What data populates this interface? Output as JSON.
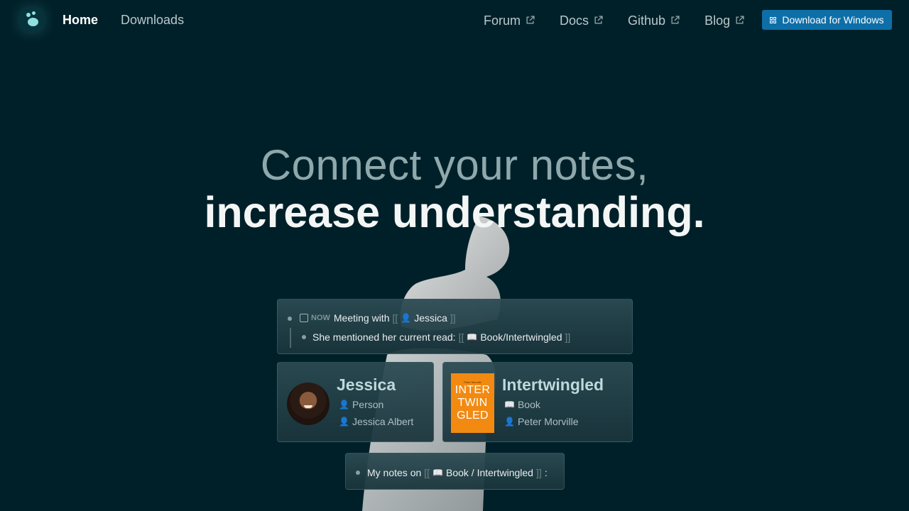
{
  "nav": {
    "home": "Home",
    "downloads": "Downloads",
    "links": [
      "Forum",
      "Docs",
      "Github",
      "Blog"
    ],
    "download_button": "Download for Windows"
  },
  "hero": {
    "line1": "Connect your notes,",
    "line2": "increase understanding."
  },
  "outline": {
    "status": "NOW",
    "meeting_text": "Meeting with",
    "meeting_ref": "Jessica",
    "mention_text": "She mentioned her current read:",
    "mention_ref": "Book/Intertwingled",
    "open_brackets": "[[",
    "close_brackets": "]]"
  },
  "person_card": {
    "title": "Jessica",
    "type": "Person",
    "full_name": "Jessica Albert"
  },
  "book_card": {
    "title": "Intertwingled",
    "type": "Book",
    "author": "Peter Morville",
    "cover_top": "Peter Morville",
    "cover_lines": [
      "INTER",
      "TWIN",
      "GLED"
    ]
  },
  "notes": {
    "prefix": "My notes on",
    "ref": "Book / Intertwingled",
    "suffix": ":"
  },
  "colors": {
    "background": "#002029",
    "accent_button": "#0e6fa8",
    "book_cover": "#f28a12"
  },
  "icons": [
    "logo-icon",
    "external-link-icon",
    "windows-icon",
    "person-icon",
    "book-icon",
    "author-icon"
  ]
}
